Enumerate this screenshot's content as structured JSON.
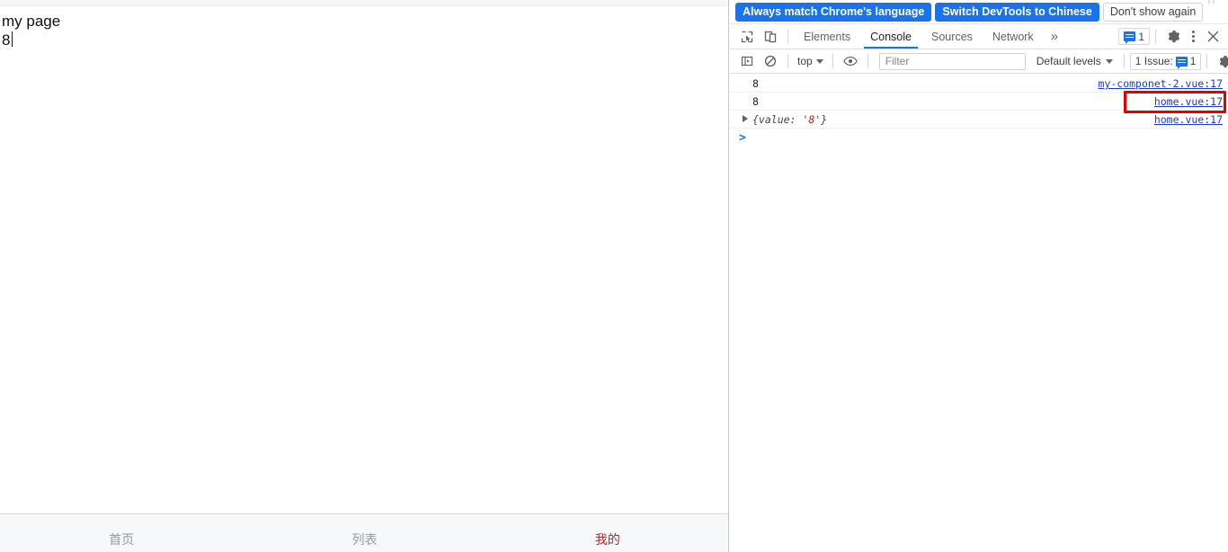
{
  "page": {
    "title_line": "my page",
    "value_line": "8",
    "tabbar": {
      "items": [
        {
          "label": "首页",
          "active": false
        },
        {
          "label": "列表",
          "active": false
        },
        {
          "label": "我的",
          "active": true
        }
      ],
      "active_color": "#c82020",
      "inactive_color": "#999999"
    }
  },
  "devtools": {
    "language_banner": {
      "primary_button": "Always match Chrome's language",
      "secondary_button": "Switch DevTools to Chinese",
      "dismiss_button": "Don't show again",
      "accent_color": "#1a73e8"
    },
    "tabstrip": {
      "inspect_icon": "inspect-element-icon",
      "device_icon": "device-toolbar-icon",
      "tabs": [
        {
          "label": "Elements",
          "active": false
        },
        {
          "label": "Console",
          "active": true
        },
        {
          "label": "Sources",
          "active": false
        },
        {
          "label": "Network",
          "active": false
        }
      ],
      "more_tabs": "»",
      "message_count": "1",
      "settings_icon": "gear-icon",
      "menu_icon": "kebab-menu-icon",
      "close_icon": "close-icon",
      "active_underline_color": "#1a73e8"
    },
    "filterbar": {
      "sidebar_icon": "console-sidebar-icon",
      "clear_icon": "clear-console-icon",
      "context": "top",
      "eye_icon": "live-expression-icon",
      "filter_placeholder": "Filter",
      "filter_value": "",
      "levels": "Default levels",
      "issues_label": "1 Issue:",
      "issues_count": "1",
      "settings_icon": "gear-icon"
    },
    "console": {
      "rows": [
        {
          "kind": "value",
          "text": "8",
          "source": "my-componet-2.vue:17",
          "highlighted": false
        },
        {
          "kind": "value",
          "text": "8",
          "source": "home.vue:17",
          "highlighted": true
        },
        {
          "kind": "object",
          "text": "{value: '8'}",
          "object_prefix": "{value: ",
          "object_string": "'8'",
          "object_suffix": "}",
          "source": "home.vue:17",
          "highlighted": false
        }
      ],
      "prompt": ">",
      "highlight_color": "#e50000",
      "link_color": "#1a3cc8",
      "string_color": "#c41a16"
    }
  }
}
